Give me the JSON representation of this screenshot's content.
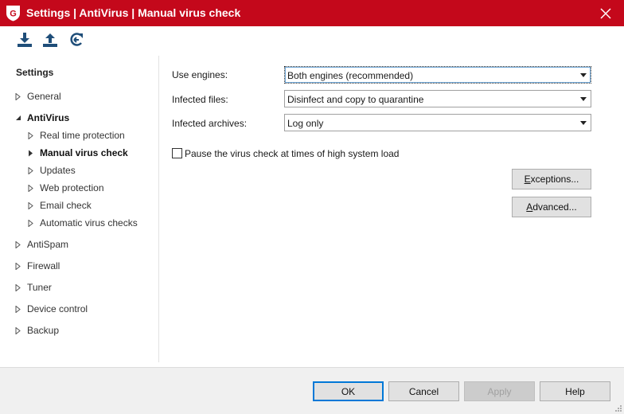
{
  "window": {
    "title": "Settings | AntiVirus | Manual virus check",
    "logo_letter": "G",
    "accent_color": "#c4081b"
  },
  "toolbar": {
    "items": [
      {
        "icon": "download-icon"
      },
      {
        "icon": "upload-icon"
      },
      {
        "icon": "restore-defaults-icon"
      }
    ]
  },
  "sidebar": {
    "heading": "Settings",
    "items": [
      {
        "label": "General",
        "level": 0
      },
      {
        "label": "AntiVirus",
        "level": 0,
        "expanded": true,
        "bold": true
      },
      {
        "label": "Real time protection",
        "level": 1
      },
      {
        "label": "Manual virus check",
        "level": 1,
        "selected": true,
        "bold": true
      },
      {
        "label": "Updates",
        "level": 1
      },
      {
        "label": "Web protection",
        "level": 1
      },
      {
        "label": "Email check",
        "level": 1
      },
      {
        "label": "Automatic virus checks",
        "level": 1
      },
      {
        "label": "AntiSpam",
        "level": 0
      },
      {
        "label": "Firewall",
        "level": 0
      },
      {
        "label": "Tuner",
        "level": 0
      },
      {
        "label": "Device control",
        "level": 0
      },
      {
        "label": "Backup",
        "level": 0
      }
    ]
  },
  "main": {
    "engines": {
      "label": "Use engines:",
      "value": "Both engines (recommended)"
    },
    "infected_files": {
      "label": "Infected files:",
      "value": "Disinfect and copy to quarantine"
    },
    "infected_archives": {
      "label": "Infected archives:",
      "value": "Log only"
    },
    "pause_check": {
      "label": "Pause the virus check at times of high system load",
      "checked": false
    },
    "exceptions_button": {
      "mnemonic": "E",
      "rest": "xceptions..."
    },
    "advanced_button": {
      "mnemonic": "A",
      "rest": "dvanced..."
    }
  },
  "footer": {
    "ok": "OK",
    "cancel": "Cancel",
    "apply": "Apply",
    "help": "Help"
  }
}
